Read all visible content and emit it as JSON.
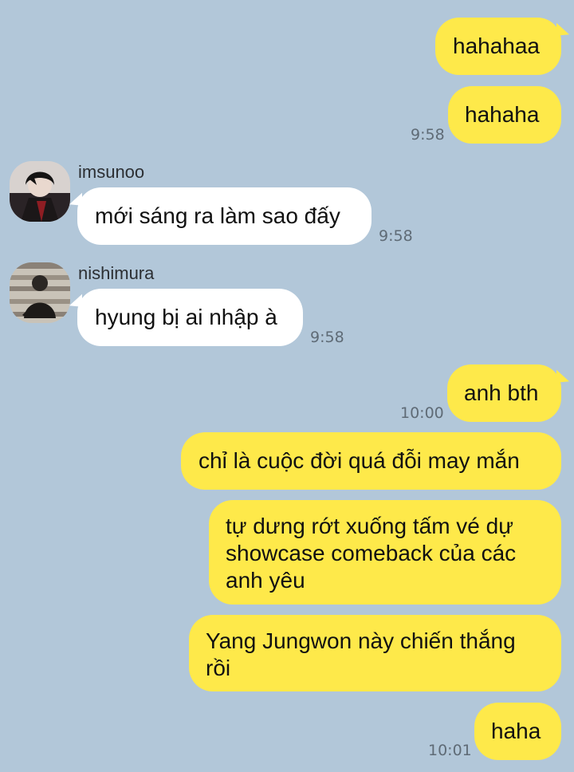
{
  "conversation": {
    "messages": [
      {
        "side": "me",
        "text": "hahahaa",
        "time": ""
      },
      {
        "side": "me",
        "text": "hahaha",
        "time": "9:58"
      },
      {
        "side": "them",
        "sender": "imsunoo",
        "avatar_icon": "user-photo-icon",
        "text": "mới sáng ra làm sao đấy",
        "time": "9:58"
      },
      {
        "side": "them",
        "sender": "nishimura",
        "avatar_icon": "user-photo-icon",
        "text": "hyung bị ai nhập à",
        "time": "9:58"
      },
      {
        "side": "me",
        "text": "anh bth",
        "time": "10:00"
      },
      {
        "side": "me",
        "text": "chỉ là cuộc đời quá đỗi may mắn",
        "time": ""
      },
      {
        "side": "me",
        "text": "tự dưng rớt xuống tấm vé dự\nshowcase comeback của các\nanh yêu",
        "time": ""
      },
      {
        "side": "me",
        "text": "Yang Jungwon này chiến thắng\nrồi",
        "time": ""
      },
      {
        "side": "me",
        "text": "haha",
        "time": "10:01"
      }
    ]
  },
  "colors": {
    "background": "#b2c7d9",
    "my_bubble": "#fee94a",
    "their_bubble": "#ffffff",
    "timestamp": "#5f6b76"
  }
}
